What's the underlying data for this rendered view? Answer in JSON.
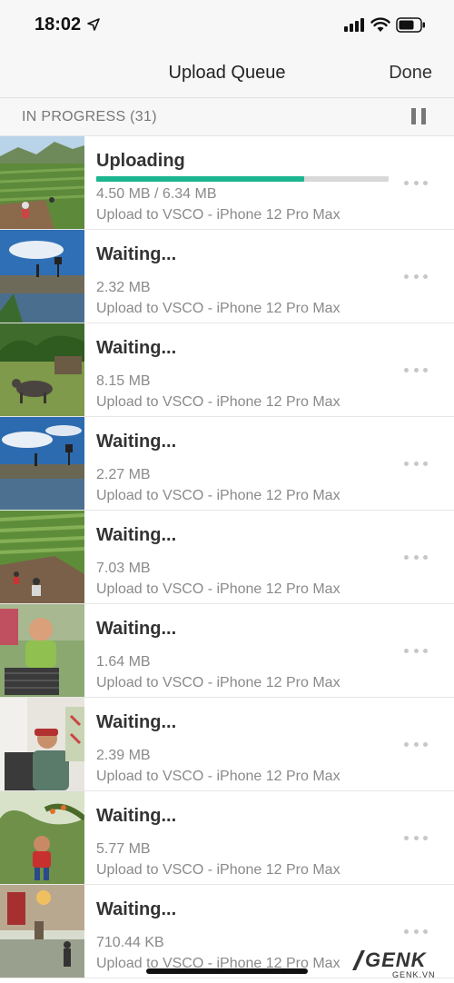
{
  "status_bar": {
    "time": "18:02"
  },
  "nav": {
    "title": "Upload Queue",
    "done_label": "Done"
  },
  "section": {
    "title": "IN PROGRESS (31)"
  },
  "progress": {
    "uploaded_fraction": 0.71
  },
  "colors": {
    "accent": "#1cb58f",
    "track": "#d8d8d8"
  },
  "items": [
    {
      "status": "Uploading",
      "size": "4.50 MB / 6.34 MB",
      "destination": "Upload to VSCO - iPhone 12 Pro Max"
    },
    {
      "status": "Waiting...",
      "size": "2.32 MB",
      "destination": "Upload to VSCO - iPhone 12 Pro Max"
    },
    {
      "status": "Waiting...",
      "size": "8.15 MB",
      "destination": "Upload to VSCO - iPhone 12 Pro Max"
    },
    {
      "status": "Waiting...",
      "size": "2.27 MB",
      "destination": "Upload to VSCO - iPhone 12 Pro Max"
    },
    {
      "status": "Waiting...",
      "size": "7.03 MB",
      "destination": "Upload to VSCO - iPhone 12 Pro Max"
    },
    {
      "status": "Waiting...",
      "size": "1.64 MB",
      "destination": "Upload to VSCO - iPhone 12 Pro Max"
    },
    {
      "status": "Waiting...",
      "size": "2.39 MB",
      "destination": "Upload to VSCO - iPhone 12 Pro Max"
    },
    {
      "status": "Waiting...",
      "size": "5.77 MB",
      "destination": "Upload to VSCO - iPhone 12 Pro Max"
    },
    {
      "status": "Waiting...",
      "size": "710.44 KB",
      "destination": "Upload to VSCO - iPhone 12 Pro Max"
    }
  ],
  "watermark": {
    "brand": "GENK",
    "domain": "GENK.VN"
  }
}
